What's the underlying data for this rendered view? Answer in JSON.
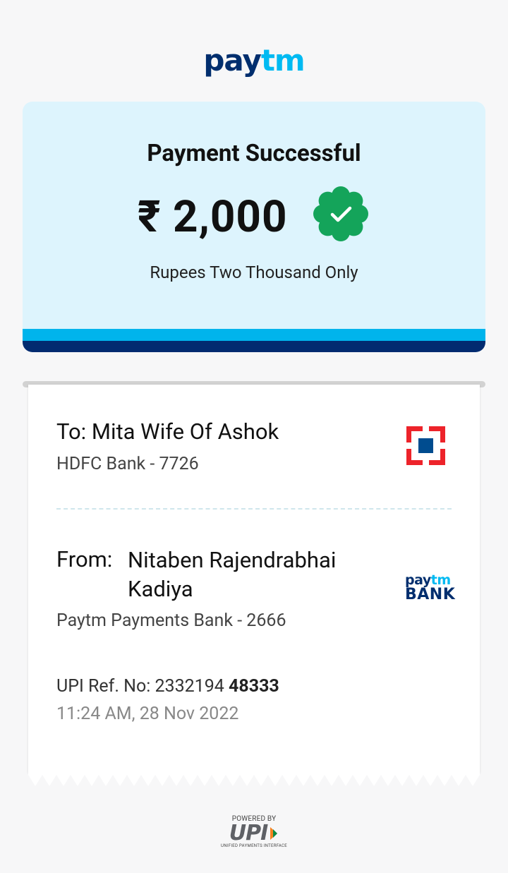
{
  "brand": {
    "logo_pay": "pay",
    "logo_tm": "tm",
    "color_dark": "#002e6e",
    "color_light": "#00baf2"
  },
  "status": {
    "title": "Payment Successful",
    "amount": "₹ 2,000",
    "amount_in_words": "Rupees Two Thousand Only",
    "badge_icon": "verified-check-icon",
    "badge_color": "#14a45a"
  },
  "recipient": {
    "label": "To:",
    "name": "Mita Wife Of Ashok",
    "bank": "HDFC Bank - 7726",
    "bank_logo_icon": "hdfc-logo-icon"
  },
  "sender": {
    "label": "From:",
    "name": "Nitaben Rajendrabhai Kadiya",
    "bank": "Paytm Payments Bank - 2666",
    "bank_logo_small_pay": "pay",
    "bank_logo_small_tm": "tm",
    "bank_logo_word": "BANK"
  },
  "transaction": {
    "upi_ref_label": "UPI Ref. No:",
    "upi_ref_prefix": "2332194",
    "upi_ref_suffix": "48333",
    "timestamp": "11:24 AM, 28 Nov 2022"
  },
  "footer": {
    "powered_by": "POWERED BY",
    "upi_mark": "UPI",
    "upi_full": "UNIFIED PAYMENTS INTERFACE"
  }
}
